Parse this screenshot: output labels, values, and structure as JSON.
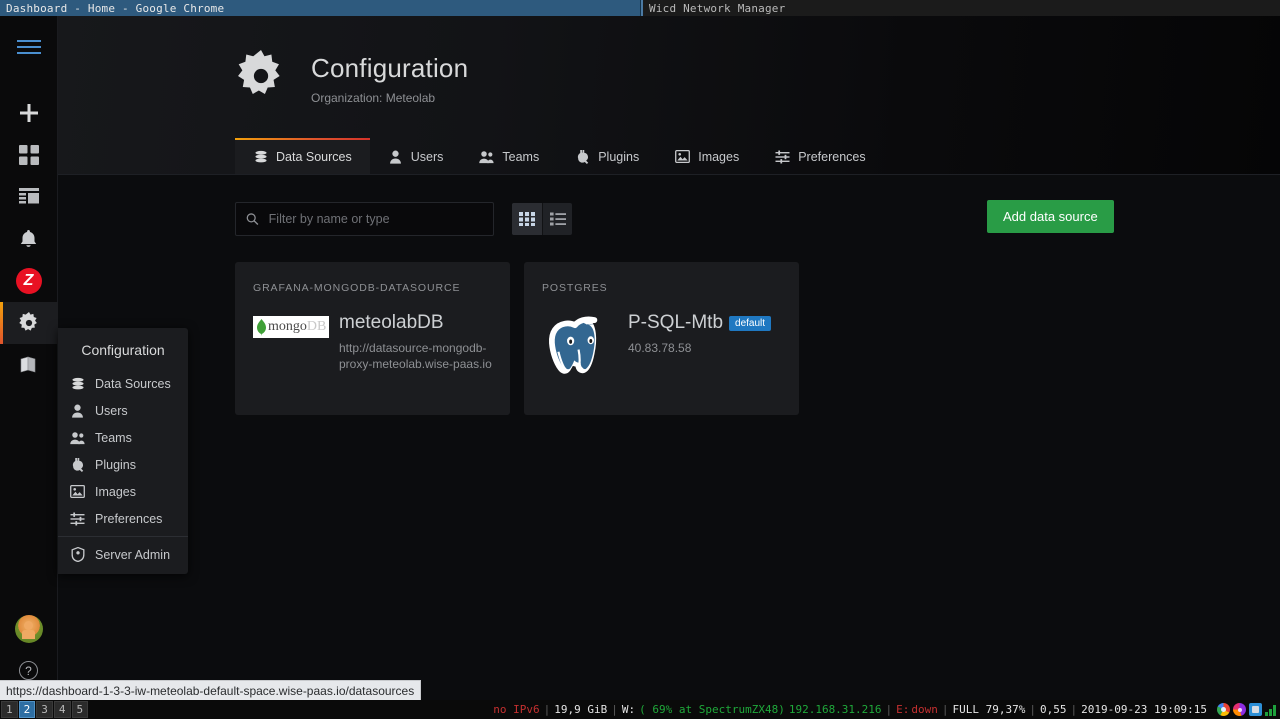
{
  "window_manager": {
    "focused_window_title": "Dashboard - Home - Google Chrome",
    "other_window_title": "Wicd Network Manager"
  },
  "sidebar": {
    "top_icons": [
      {
        "name": "menu-icon",
        "label": "Menu"
      },
      {
        "name": "plus-icon",
        "label": "Create"
      },
      {
        "name": "dashboards-icon",
        "label": "Dashboards"
      },
      {
        "name": "explore-icon",
        "label": "Explore"
      },
      {
        "name": "alerting-icon",
        "label": "Alerting"
      },
      {
        "name": "zabbix-icon",
        "label": "Z"
      },
      {
        "name": "gear-icon",
        "label": "Configuration"
      },
      {
        "name": "book-icon",
        "label": "Docs"
      }
    ],
    "bottom_icons": [
      {
        "name": "avatar",
        "label": "User"
      },
      {
        "name": "help-icon",
        "label": "?"
      }
    ]
  },
  "dropdown": {
    "title": "Configuration",
    "items": [
      {
        "label": "Data Sources",
        "icon": "database-icon"
      },
      {
        "label": "Users",
        "icon": "user-icon"
      },
      {
        "label": "Teams",
        "icon": "users-icon"
      },
      {
        "label": "Plugins",
        "icon": "plug-icon"
      },
      {
        "label": "Images",
        "icon": "image-icon"
      },
      {
        "label": "Preferences",
        "icon": "sliders-icon"
      }
    ],
    "footer_items": [
      {
        "label": "Server Admin",
        "icon": "shield-icon"
      }
    ]
  },
  "header": {
    "title": "Configuration",
    "subtitle": "Organization: Meteolab",
    "icon": "gear-icon"
  },
  "tabs": [
    {
      "label": "Data Sources",
      "icon": "database-icon",
      "active": true
    },
    {
      "label": "Users",
      "icon": "user-icon",
      "active": false
    },
    {
      "label": "Teams",
      "icon": "users-icon",
      "active": false
    },
    {
      "label": "Plugins",
      "icon": "plug-icon",
      "active": false
    },
    {
      "label": "Images",
      "icon": "image-icon",
      "active": false
    },
    {
      "label": "Preferences",
      "icon": "sliders-icon",
      "active": false
    }
  ],
  "toolbar": {
    "filter_placeholder": "Filter by name or type",
    "filter_value": "",
    "search_icon": "search-icon",
    "view_grid_label": "Grid view",
    "view_list_label": "List view",
    "active_view": "grid",
    "add_button_label": "Add data source",
    "add_button_color": "#299c46"
  },
  "data_sources": [
    {
      "type": "GRAFANA-MONGODB-DATASOURCE",
      "name": "meteolabDB",
      "url": "http://datasource-mongodb-proxy-meteolab.wise-paas.io",
      "logo": "mongodb-logo",
      "logo_text_main": "mongo",
      "logo_text_sub": "DB",
      "is_default": false,
      "badge": ""
    },
    {
      "type": "POSTGRES",
      "name": "P-SQL-Mtb",
      "url": "40.83.78.58",
      "logo": "postgresql-logo",
      "is_default": true,
      "badge": "default",
      "badge_color": "#1f78c1"
    }
  ],
  "browser": {
    "status_url": "https://dashboard-1-3-3-iw-meteolab-default-space.wise-paas.io/datasources"
  },
  "statusbar": {
    "workspaces": [
      {
        "label": "1",
        "active": false
      },
      {
        "label": "2",
        "active": true
      },
      {
        "label": "3",
        "active": false
      },
      {
        "label": "4",
        "active": false
      },
      {
        "label": "5",
        "active": false
      }
    ],
    "ipv6": "no IPv6",
    "disk": "19,9 GiB",
    "wifi_prefix": "W:",
    "wifi": "( 69% at SpectrumZX48)",
    "ip": "192.168.31.216",
    "ethernet_prefix": "E:",
    "ethernet": "down",
    "battery": "FULL 79,37%",
    "load": "0,55",
    "datetime": "2019-09-23 19:09:15"
  }
}
